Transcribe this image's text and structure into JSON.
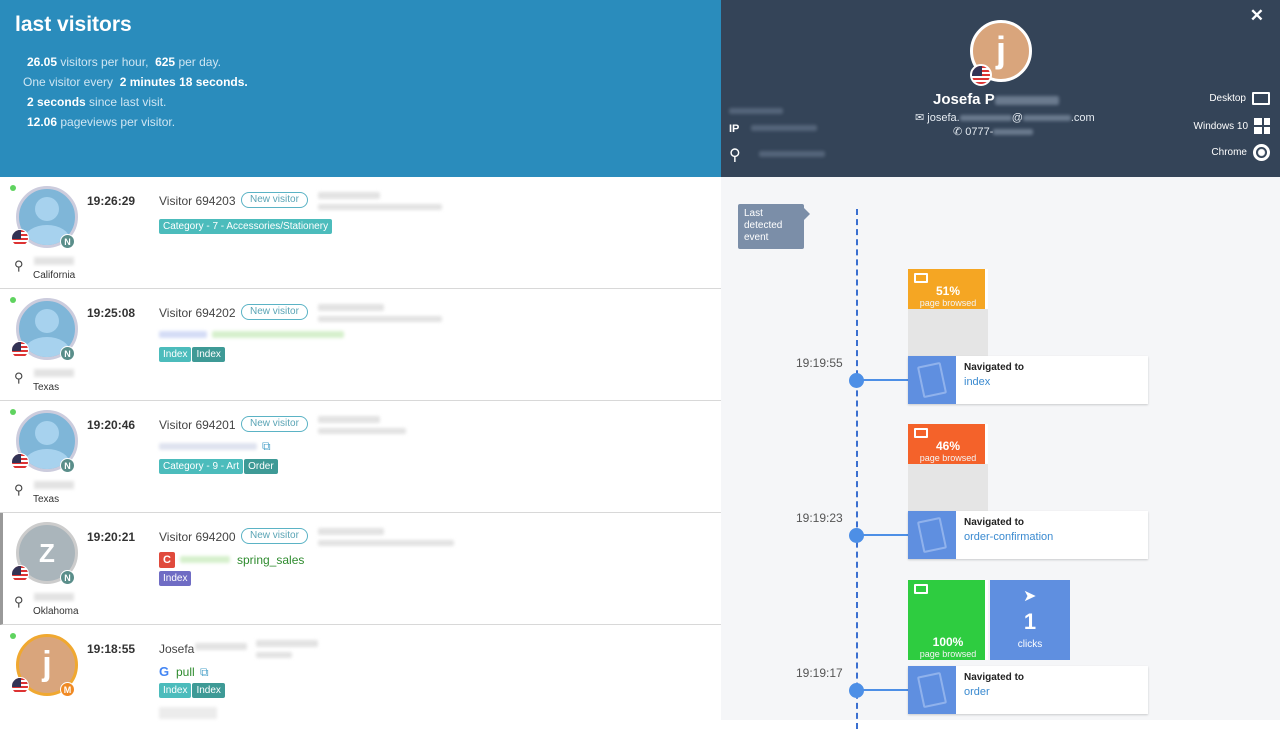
{
  "header": {
    "title": "last visitors",
    "stats": {
      "visitors_per_hour": "26.05",
      "visitors_per_hour_label": " visitors per hour,",
      "per_day": "625",
      "per_day_label": " per day.",
      "one_every_label": "One visitor every",
      "minutes": "2 minutes",
      "seconds": "18 seconds.",
      "since_last_value": "2 seconds",
      "since_last_label": " since last visit.",
      "pageviews": "12.06",
      "pageviews_label": " pageviews per visitor."
    }
  },
  "visitors": [
    {
      "time": "19:26:29",
      "name": "Visitor 694203",
      "new_label": "New visitor",
      "city": "California",
      "badge": "N",
      "tags": [
        "Category - 7 - Accessories/Stationery"
      ]
    },
    {
      "time": "19:25:08",
      "name": "Visitor 694202",
      "new_label": "New visitor",
      "city": "Texas",
      "badge": "N",
      "tags": [
        "Index",
        "Index"
      ]
    },
    {
      "time": "19:20:46",
      "name": "Visitor 694201",
      "new_label": "New visitor",
      "city": "Texas",
      "badge": "N",
      "tags": [
        "Category - 9 - Art",
        "Order"
      ]
    },
    {
      "time": "19:20:21",
      "name": "Visitor 694200",
      "new_label": "New visitor",
      "city": "Oklahoma",
      "badge": "N",
      "avatar_letter": "Z",
      "campaign": "spring_sales",
      "campaign_icon": "C",
      "tags": [
        "Index"
      ]
    },
    {
      "time": "19:18:55",
      "name": "Josefa",
      "badge": "M",
      "avatar_letter": "j",
      "referrer": "pull",
      "referrer_icon": "G",
      "tags": [
        "Index",
        "Index"
      ]
    }
  ],
  "profile": {
    "close_icon": "✕",
    "avatar_letter": "j",
    "name": "Josefa P",
    "email_prefix": "josefa.",
    "email_suffix": "@",
    "email_tld": ".com",
    "phone": "0777-",
    "ip_label": "IP",
    "device": "Desktop",
    "os": "Windows 10",
    "browser": "Chrome"
  },
  "timeline": {
    "last_event_label": "Last detected event",
    "events": [
      {
        "percent": "51%",
        "percent_label": "page browsed",
        "color": "#f5a623",
        "time": "19:19:55",
        "nav_title": "Navigated to",
        "page": "index"
      },
      {
        "percent": "46%",
        "percent_label": "page browsed",
        "color": "#f4622a",
        "time": "19:19:23",
        "nav_title": "Navigated to",
        "page": "order-confirmation"
      },
      {
        "percent": "100%",
        "percent_label": "page browsed",
        "color": "#2ecc40",
        "time": "19:19:17",
        "nav_title": "Navigated to",
        "page": "order",
        "clicks": "1",
        "clicks_label": "clicks"
      }
    ]
  }
}
